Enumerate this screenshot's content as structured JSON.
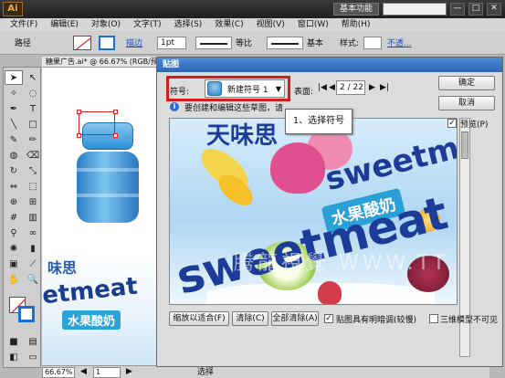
{
  "app": {
    "logo": "Ai",
    "workspace": "基本功能",
    "window_buttons": [
      "—",
      "□",
      "✕"
    ]
  },
  "menubar": {
    "items": [
      "文件(F)",
      "编辑(E)",
      "对象(O)",
      "文字(T)",
      "选择(S)",
      "效果(C)",
      "视图(V)",
      "窗口(W)",
      "帮助(H)"
    ]
  },
  "controlbar": {
    "path_label": "路径",
    "stroke_label": "描边",
    "stroke_weight": "1pt",
    "uniform_label": "等比",
    "basic_label": "基本",
    "style_label": "样式:",
    "opacity_link": "不透..."
  },
  "document": {
    "tab_title": "糖果广告.ai* @ 66.67% (RGB/预览)",
    "thumb_title": "味思",
    "thumb_word": "etmeat",
    "thumb_badge": "水果酸奶"
  },
  "statusbar": {
    "zoom": "66.67%",
    "page": "1",
    "status": "选择"
  },
  "dialog": {
    "title": "贴图",
    "symbol_label": "符号:",
    "symbol_value": "新建符号 1",
    "surface_label": "表面:",
    "surface_value": "2 / 22",
    "info_text": "要创建和编辑这些草图，请",
    "callout": "1、选择符号",
    "preview": {
      "title_text": "天味思",
      "word_main": "sweetmeat",
      "word_second": "sweetmeat",
      "badge": "水果酸奶",
      "watermark": "腾龍視覺 WWW.TT.NET"
    },
    "buttons": {
      "ok": "确定",
      "cancel": "取消",
      "shrink": "缩放以适合(F)",
      "clear": "清除(C)",
      "clear_all": "全部清除(A)"
    },
    "checkboxes": {
      "preview": "预览(P)",
      "shade": "贴图具有明暗调(较慢)",
      "invisible": "三维模型不可见"
    },
    "colors": {
      "highlight": "#d41d1d",
      "title_bar": "#2e66b4"
    }
  }
}
